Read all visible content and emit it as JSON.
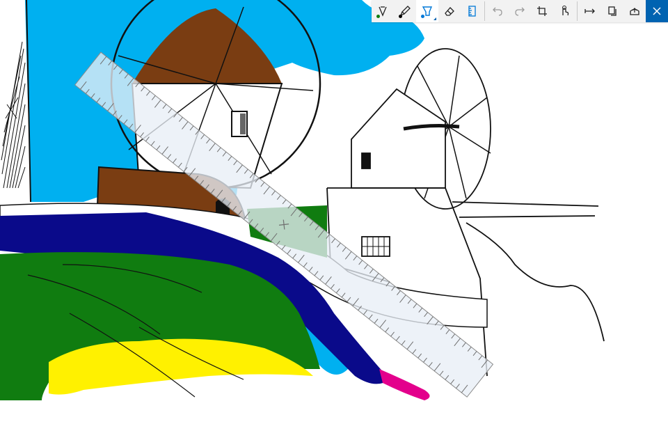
{
  "toolbar": {
    "tools": [
      {
        "name": "ballpoint-pen",
        "icon": "ballpoint-pen-icon",
        "color": "#107c10",
        "active": false
      },
      {
        "name": "pencil",
        "icon": "pencil-icon",
        "color": "#000000",
        "active": false
      },
      {
        "name": "highlighter",
        "icon": "highlighter-icon",
        "color": "#0078d7",
        "active": true
      },
      {
        "name": "eraser",
        "icon": "eraser-icon",
        "active": false
      },
      {
        "name": "ruler",
        "icon": "ruler-icon",
        "active": false
      }
    ],
    "actions": [
      {
        "name": "undo",
        "icon": "undo-icon"
      },
      {
        "name": "redo",
        "icon": "redo-icon"
      },
      {
        "name": "crop",
        "icon": "crop-icon"
      },
      {
        "name": "touch-writing",
        "icon": "touch-writing-icon"
      }
    ],
    "share": [
      {
        "name": "save",
        "icon": "save-icon"
      },
      {
        "name": "copy",
        "icon": "copy-icon"
      },
      {
        "name": "share",
        "icon": "share-icon"
      }
    ],
    "close": {
      "icon": "close-icon"
    }
  },
  "colors": {
    "sky": "#00b0f0",
    "dark-blue": "#0a0a8a",
    "green": "#107c10",
    "yellow": "#fff100",
    "brown": "#7a3d12",
    "magenta": "#e3008c",
    "accent": "#0063b1"
  }
}
